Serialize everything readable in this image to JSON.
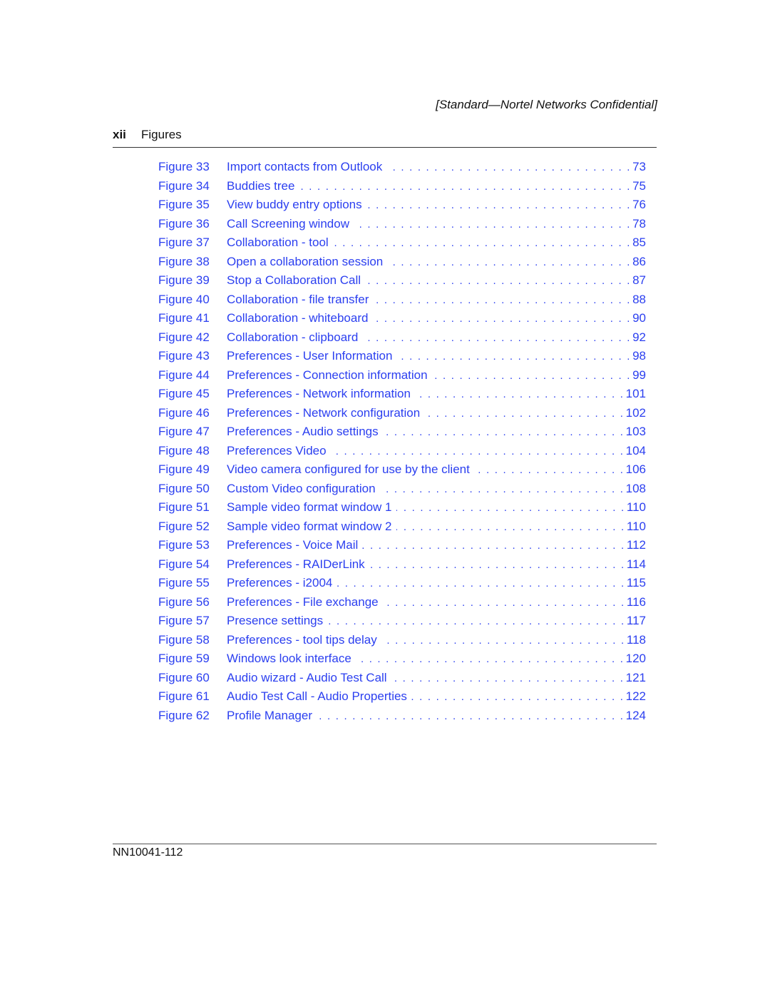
{
  "header": {
    "confidential": "[Standard—Nortel Networks Confidential]",
    "page_number": "xii",
    "section": "Figures"
  },
  "colors": {
    "link": "#2b3ff0",
    "text": "#111111"
  },
  "toc": [
    {
      "figure": "Figure 33",
      "title": "Import contacts from Outlook",
      "page": "73"
    },
    {
      "figure": "Figure 34",
      "title": "Buddies tree",
      "page": "75"
    },
    {
      "figure": "Figure 35",
      "title": "View buddy entry options",
      "page": "76"
    },
    {
      "figure": "Figure 36",
      "title": "Call Screening window",
      "page": "78"
    },
    {
      "figure": "Figure 37",
      "title": "Collaboration - tool",
      "page": "85"
    },
    {
      "figure": "Figure 38",
      "title": "Open a collaboration session",
      "page": "86"
    },
    {
      "figure": "Figure 39",
      "title": "Stop a Collaboration Call",
      "page": "87"
    },
    {
      "figure": "Figure 40",
      "title": "Collaboration - file transfer",
      "page": "88"
    },
    {
      "figure": "Figure 41",
      "title": "Collaboration - whiteboard",
      "page": "90"
    },
    {
      "figure": "Figure 42",
      "title": "Collaboration - clipboard",
      "page": "92"
    },
    {
      "figure": "Figure 43",
      "title": "Preferences - User Information",
      "page": "98"
    },
    {
      "figure": "Figure 44",
      "title": "Preferences - Connection information",
      "page": "99"
    },
    {
      "figure": "Figure 45",
      "title": "Preferences - Network information",
      "page": "101"
    },
    {
      "figure": "Figure 46",
      "title": "Preferences - Network configuration",
      "page": "102"
    },
    {
      "figure": "Figure 47",
      "title": "Preferences - Audio settings",
      "page": "103"
    },
    {
      "figure": "Figure 48",
      "title": "Preferences Video",
      "page": "104"
    },
    {
      "figure": "Figure 49",
      "title": "Video camera configured for use by the client",
      "page": "106"
    },
    {
      "figure": "Figure 50",
      "title": "Custom Video configuration",
      "page": "108"
    },
    {
      "figure": "Figure 51",
      "title": "Sample video format window 1",
      "page": "110"
    },
    {
      "figure": "Figure 52",
      "title": "Sample video format window 2",
      "page": "110"
    },
    {
      "figure": "Figure 53",
      "title": "Preferences - Voice Mail",
      "page": "112"
    },
    {
      "figure": "Figure 54",
      "title": "Preferences - RAIDerLink",
      "page": "114"
    },
    {
      "figure": "Figure 55",
      "title": "Preferences - i2004",
      "page": "115"
    },
    {
      "figure": "Figure 56",
      "title": "Preferences - File exchange",
      "page": "116"
    },
    {
      "figure": "Figure 57",
      "title": "Presence settings",
      "page": "117"
    },
    {
      "figure": "Figure 58",
      "title": "Preferences - tool tips delay",
      "page": "118"
    },
    {
      "figure": "Figure 59",
      "title": "Windows look interface",
      "page": "120"
    },
    {
      "figure": "Figure 60",
      "title": "Audio wizard - Audio Test Call",
      "page": "121"
    },
    {
      "figure": "Figure 61",
      "title": "Audio Test Call - Audio Properties",
      "page": "122"
    },
    {
      "figure": "Figure 62",
      "title": "Profile Manager",
      "page": "124"
    }
  ],
  "footer": {
    "doc_number": "NN10041-112"
  }
}
